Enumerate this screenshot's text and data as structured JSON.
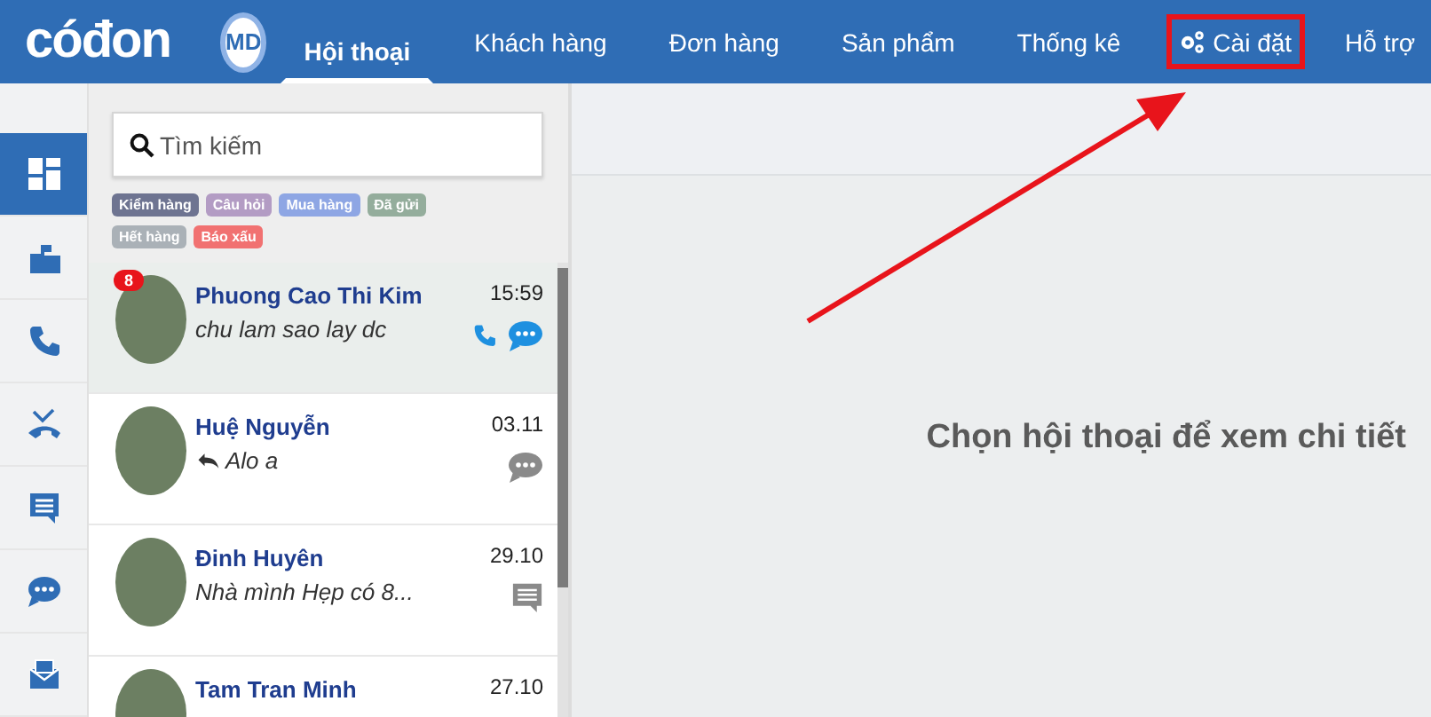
{
  "topbar": {
    "logo": "cóđon",
    "account_badge": "MD",
    "nav": [
      {
        "label": "Hội thoại",
        "selected": true,
        "highlighted": false
      },
      {
        "label": "Khách hàng",
        "selected": false,
        "highlighted": false
      },
      {
        "label": "Đơn hàng",
        "selected": false,
        "highlighted": false
      },
      {
        "label": "Sản phẩm",
        "selected": false,
        "highlighted": false
      },
      {
        "label": "Thống kê",
        "selected": false,
        "highlighted": false
      },
      {
        "label": "Cài đặt",
        "selected": false,
        "highlighted": true,
        "kind": "gears"
      },
      {
        "label": "Hỗ trợ",
        "selected": false,
        "highlighted": false
      }
    ]
  },
  "rail": [
    {
      "kind": "dashboard",
      "selected": true
    },
    {
      "kind": "inbox",
      "selected": false
    },
    {
      "kind": "phone",
      "selected": false
    },
    {
      "kind": "missed-call",
      "selected": false
    },
    {
      "kind": "message",
      "selected": false
    },
    {
      "kind": "chat",
      "selected": false
    },
    {
      "kind": "mail",
      "selected": false
    }
  ],
  "search": {
    "placeholder": "Tìm kiếm"
  },
  "tags": [
    {
      "label": "Kiểm hàng",
      "color": "#6e7491"
    },
    {
      "label": "Câu hỏi",
      "color": "#b39cc4"
    },
    {
      "label": "Mua hàng",
      "color": "#8ea6e4"
    },
    {
      "label": "Đã gửi",
      "color": "#94ad9c"
    },
    {
      "label": "Hết hàng",
      "color": "#aab1b7"
    },
    {
      "label": "Báo xấu",
      "color": "#f17171"
    }
  ],
  "conversations": [
    {
      "name": "Phuong Cao Thi Kim",
      "preview": "chu lam sao lay dc",
      "time": "15:59",
      "unread": "8",
      "replied": false,
      "selected": true,
      "icons": [
        {
          "kind": "phone",
          "highlighted": true
        },
        {
          "kind": "chat",
          "highlighted": true
        }
      ]
    },
    {
      "name": "Huệ Nguyễn",
      "preview": "Alo a",
      "time": "03.11",
      "replied": true,
      "selected": false,
      "icons": [
        {
          "kind": "chat",
          "highlighted": false
        }
      ]
    },
    {
      "name": "Đinh Huyên",
      "preview": "Nhà mình Hẹp có 8...",
      "time": "29.10",
      "replied": false,
      "selected": false,
      "icons": [
        {
          "kind": "comment",
          "highlighted": false
        }
      ]
    },
    {
      "name": "Tam Tran Minh",
      "time": "27.10",
      "selected": false
    }
  ],
  "main": {
    "empty_message": "Chọn hội thoại để xem chi tiết"
  },
  "annotation": {
    "arrow": true
  }
}
